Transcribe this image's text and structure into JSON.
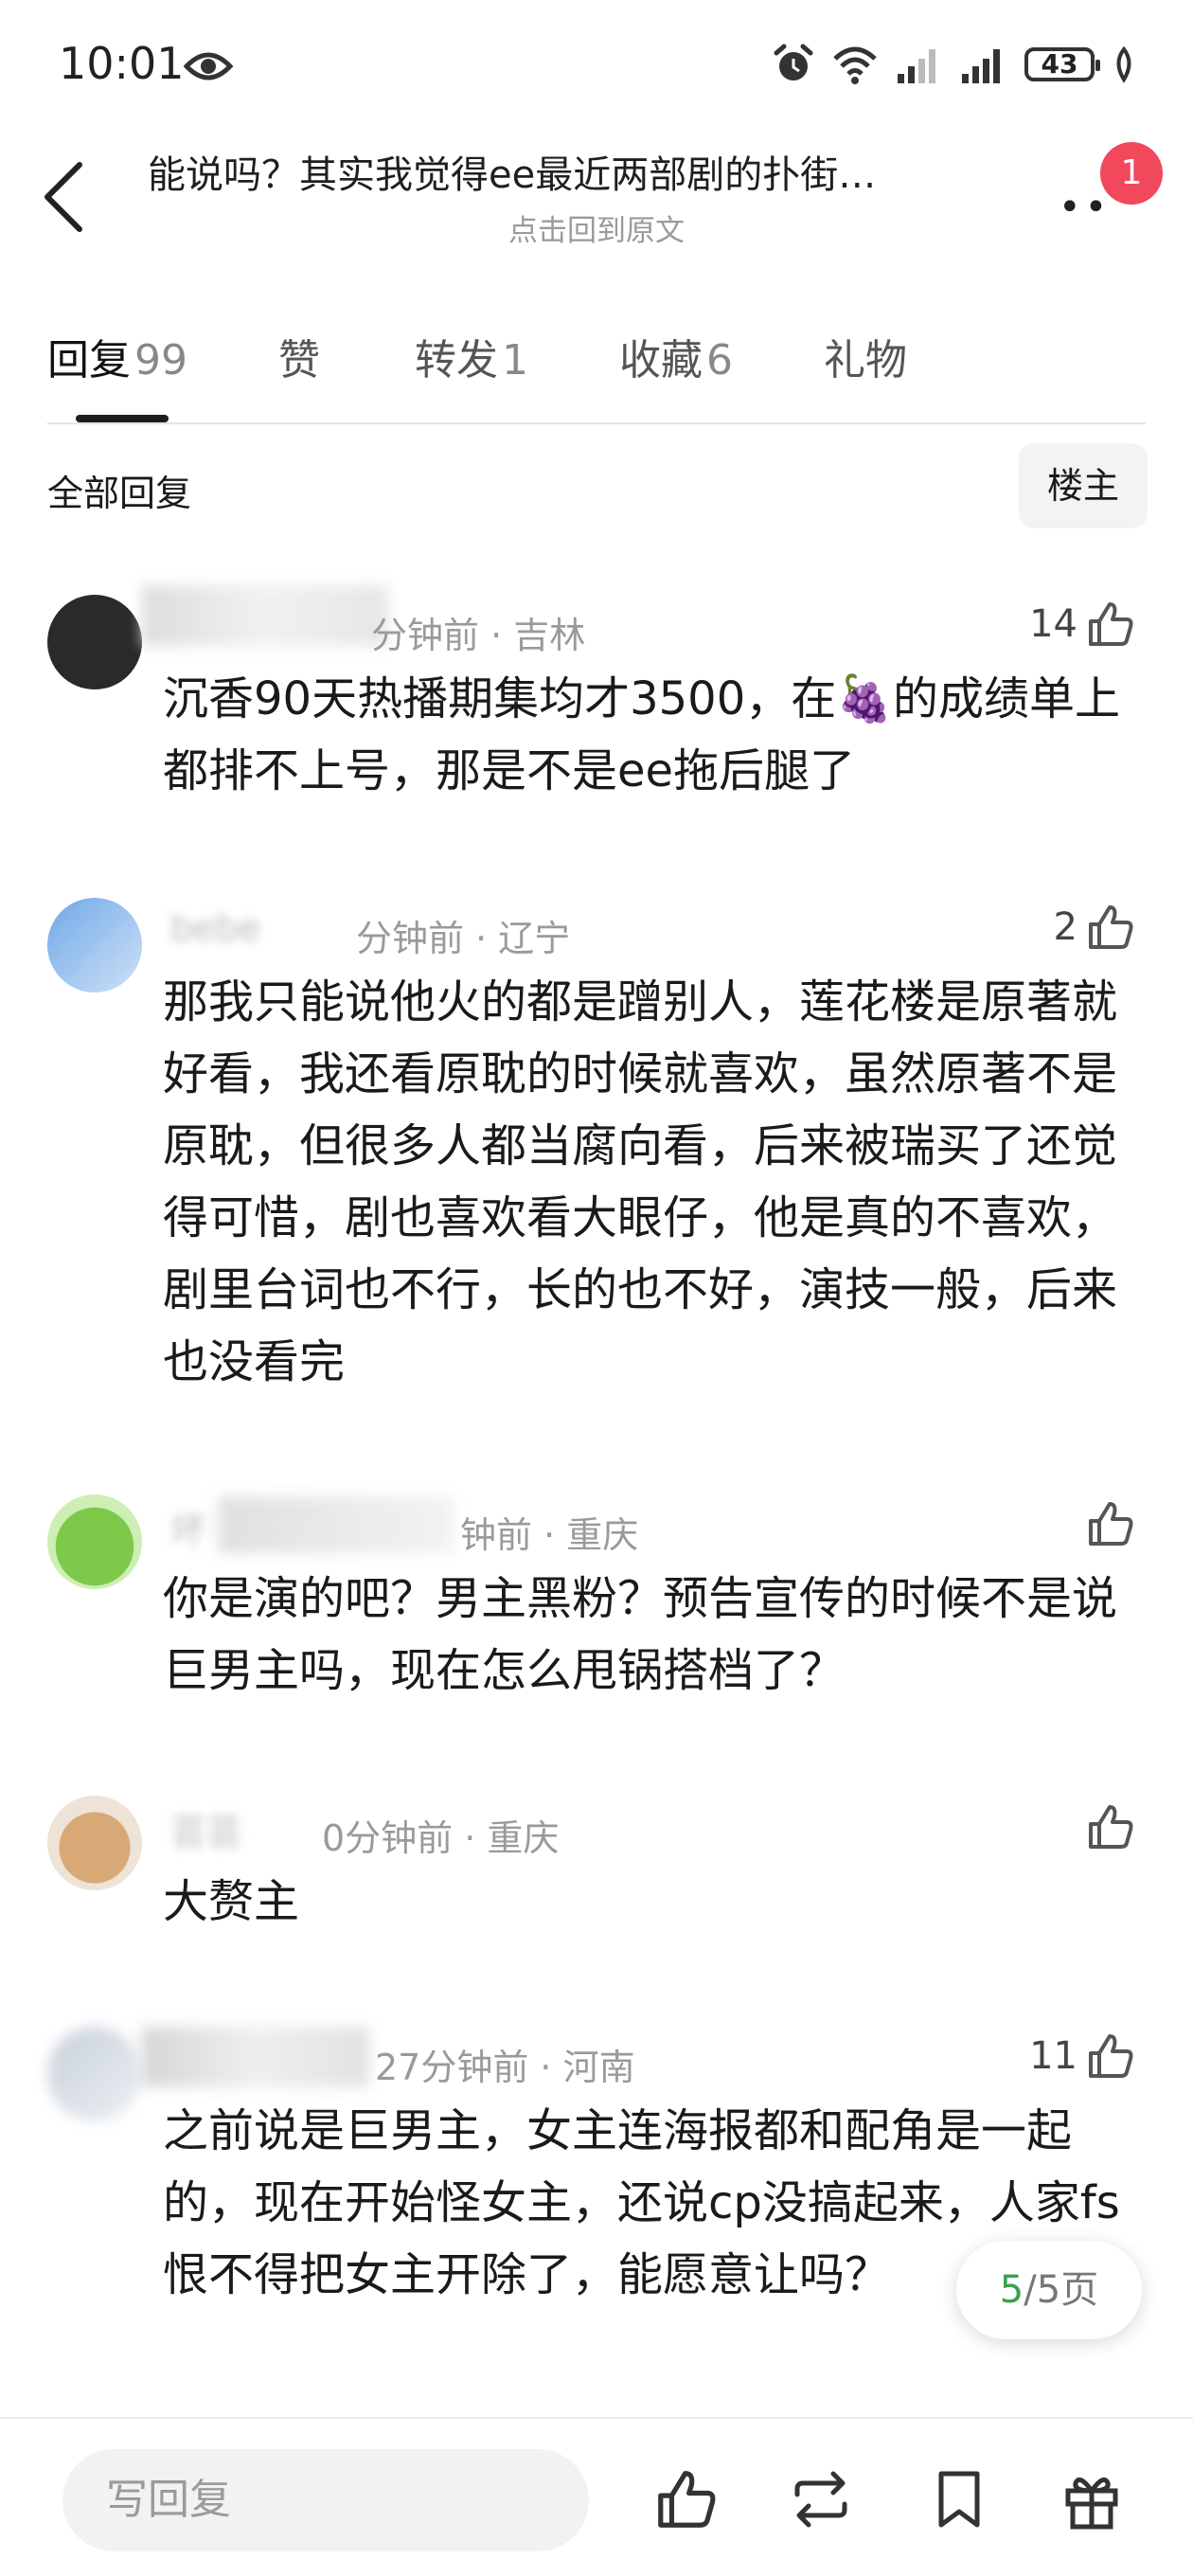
{
  "status_bar": {
    "time": "10:01",
    "battery": "43"
  },
  "header": {
    "title": "能说吗？其实我觉得ee最近两部剧的扑街…",
    "subtitle": "点击回到原文",
    "notification_count": "1"
  },
  "tabs": [
    {
      "label": "回复",
      "count": "99"
    },
    {
      "label": "赞",
      "count": ""
    },
    {
      "label": "转发",
      "count": "1"
    },
    {
      "label": "收藏",
      "count": "6"
    },
    {
      "label": "礼物",
      "count": ""
    }
  ],
  "filter": {
    "all_label": "全部回复",
    "op_label": "楼主"
  },
  "comments": [
    {
      "meta": "分钟前 · 吉林",
      "likes": "14",
      "text": "沉香90天热播期集均才3500，在🍇的成绩单上都排不上号，那是不是ee拖后腿了"
    },
    {
      "name": "bebe",
      "meta": "分钟前 · 辽宁",
      "likes": "2",
      "text": "那我只能说他火的都是蹭别人，莲花楼是原著就好看，我还看原耽的时候就喜欢，虽然原著不是原耽，但很多人都当腐向看，后来被瑞买了还觉得可惜，剧也喜欢看大眼仔，他是真的不喜欢，剧里台词也不行，长的也不好，演技一般，后来也没看完"
    },
    {
      "name": "坏",
      "meta": "钟前 · 重庆",
      "likes": "",
      "text": "你是演的吧？男主黑粉？预告宣传的时候不是说巨男主吗，现在怎么甩锅搭档了？"
    },
    {
      "name": "芸芸",
      "meta": "0分钟前 · 重庆",
      "likes": "",
      "text": "大赘主"
    },
    {
      "meta": "27分钟前 · 河南",
      "likes": "11",
      "text": "之前说是巨男主，女主连海报都和配角是一起的，现在开始怪女主，还说cp没搞起来，人家fs恨不得把女主开除了，能愿意让吗？"
    }
  ],
  "pager": {
    "current": "5",
    "total": "/5页"
  },
  "bottom_bar": {
    "reply_placeholder": "写回复"
  }
}
